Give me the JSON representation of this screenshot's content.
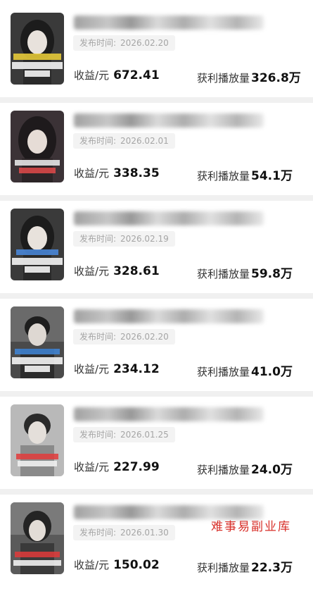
{
  "list": {
    "items": [
      {
        "title": "",
        "date_label": "发布时间:",
        "date": "2026.02.20",
        "income_label": "收益/元",
        "income": "672.41",
        "plays_label": "获利播放量",
        "plays": "326.8万",
        "thumb_bg": "#3a3a3a",
        "thumb_accent": "#f0d23a"
      },
      {
        "title": "",
        "date_label": "发布时间:",
        "date": "2026.02.01",
        "income_label": "收益/元",
        "income": "338.35",
        "plays_label": "获利播放量",
        "plays": "54.1万",
        "thumb_bg": "#3b3236",
        "thumb_accent": "#e24a4a"
      },
      {
        "title": "",
        "date_label": "发布时间:",
        "date": "2026.02.19",
        "income_label": "收益/元",
        "income": "328.61",
        "plays_label": "获利播放量",
        "plays": "59.8万",
        "thumb_bg": "#3a3a3a",
        "thumb_accent": "#4a8be0"
      },
      {
        "title": "",
        "date_label": "发布时间:",
        "date": "2026.02.20",
        "income_label": "收益/元",
        "income": "234.12",
        "plays_label": "获利播放量",
        "plays": "41.0万",
        "thumb_bg": "#4a4a4a",
        "thumb_accent": "#3f86d8"
      },
      {
        "title": "",
        "date_label": "发布时间:",
        "date": "2026.01.25",
        "income_label": "收益/元",
        "income": "227.99",
        "plays_label": "获利播放量",
        "plays": "24.0万",
        "thumb_bg": "#b9b9b9",
        "thumb_accent": "#e23b3b"
      },
      {
        "title": "",
        "date_label": "发布时间:",
        "date": "2026.01.30",
        "income_label": "收益/元",
        "income": "150.02",
        "plays_label": "获利播放量",
        "plays": "22.3万",
        "thumb_bg": "#5a5a5a",
        "thumb_accent": "#e23b3b"
      }
    ]
  },
  "watermark": "难事易副业库"
}
